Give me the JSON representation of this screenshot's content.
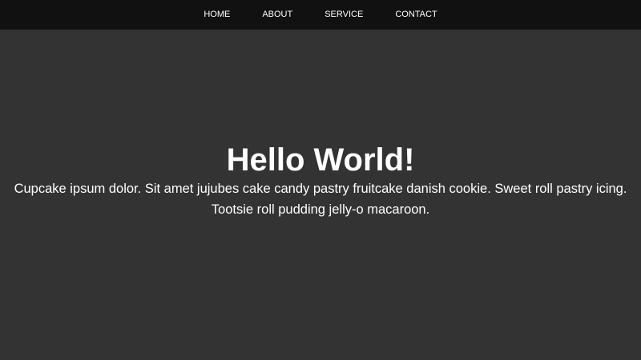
{
  "nav": {
    "items": [
      {
        "label": "HOME"
      },
      {
        "label": "ABOUT"
      },
      {
        "label": "SERVICE"
      },
      {
        "label": "CONTACT"
      }
    ]
  },
  "hero": {
    "title": "Hello World!",
    "text": "Cupcake ipsum dolor. Sit amet jujubes cake candy pastry fruitcake danish cookie. Sweet roll pastry icing. Tootsie roll pudding jelly-o macaroon."
  },
  "colors": {
    "navbar_bg": "#111111",
    "page_bg": "#333333",
    "text": "#ffffff"
  }
}
